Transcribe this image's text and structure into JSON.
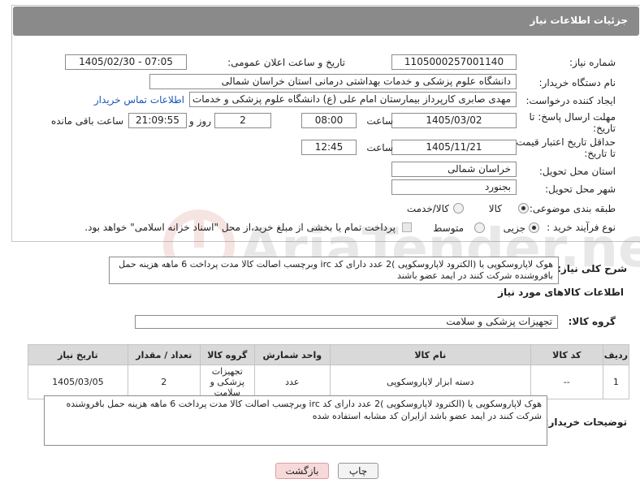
{
  "header": {
    "title": "جزئیات اطلاعات نیاز"
  },
  "fields": {
    "need_number_label": "شماره نیاز:",
    "need_number": "1105000257001140",
    "announce_label": "تاریخ و ساعت اعلان عمومی:",
    "announce_value": "1405/02/30 - 07:05",
    "buyer_org_label": "نام دستگاه خریدار:",
    "buyer_org": "دانشگاه علوم پزشکی و خدمات بهداشتی درمانی استان خراسان شمالی",
    "requester_label": "ایجاد کننده درخواست:",
    "requester": "مهدی صابری کارپرداز بیمارستان امام علی (ع) دانشگاه علوم پزشکی و خدمات ب",
    "contact_link": "اطلاعات تماس خریدار",
    "deadline_label_1": "مهلت ارسال پاسخ: تا",
    "deadline_label_2": "تاریخ:",
    "deadline_date": "1405/03/02",
    "time_label": "ساعت",
    "deadline_time": "08:00",
    "days_value": "2",
    "days_label": "روز و",
    "remaining_time": "21:09:55",
    "remaining_label": "ساعت باقی مانده",
    "validity_label_1": "حداقل تاریخ اعتبار قیمت:",
    "validity_label_2": "تا تاریخ:",
    "validity_date": "1405/11/21",
    "validity_time": "12:45",
    "province_label": "استان محل تحویل:",
    "province": "خراسان شمالی",
    "city_label": "شهر محل تحویل:",
    "city": "بجنورد",
    "category_label": "طبقه بندی موضوعی:",
    "category_options": [
      "کالا",
      "کالا/خدمت"
    ],
    "category_selected": "کالا",
    "process_label": "نوع فرآیند خرید :",
    "process_options": [
      "جزیی",
      "متوسط"
    ],
    "process_selected": "جزیی",
    "payment_note": "پرداخت تمام یا بخشی از مبلغ خرید،از محل \"اسناد خزانه اسلامی\" خواهد بود."
  },
  "description": {
    "label": "شرح کلی نیاز:",
    "text": "هوک لاپاروسکوپی یا (الکترود لاپاروسکوپی )2 عدد دارای کد irc وبرچسب اصالت کالا مدت پرداخت 6 ماهه هزینه حمل بافروشنده شرکت کنند در ایمد عضو باشند"
  },
  "goods_info": {
    "title": "اطلاعات کالاهای مورد نیاز",
    "group_label": "گروه کالا:",
    "group_value": "تجهیزات پزشکی و سلامت"
  },
  "table": {
    "headers": [
      "ردیف",
      "کد کالا",
      "نام کالا",
      "واحد شمارش",
      "گروه کالا",
      "تعداد / مقدار",
      "تاریخ نیاز"
    ],
    "rows": [
      {
        "row": "1",
        "code": "--",
        "name": "دسته ابزار لاپاروسکوپی",
        "unit": "عدد",
        "group": "تجهیزات پزشکی و سلامت",
        "qty": "2",
        "date": "1405/03/05"
      }
    ]
  },
  "buyer_notes": {
    "label": "توضیحات خریدار:",
    "text": "هوک لاپاروسکوپی یا (الکترود لاپاروسکوپی )2 عدد دارای کد irc وبرچسب اصالت کالا مدت پرداخت 6 ماهه هزینه حمل بافروشنده شرکت کنند در ایمد عضو باشد ازایران کد مشابه استفاده شده"
  },
  "buttons": {
    "print": "چاپ",
    "back": "بازگشت"
  },
  "watermark": {
    "text": "AriaTender.neT"
  },
  "colors": {
    "header_bg": "#8a8a8a",
    "link": "#1a56b8",
    "back_btn_bg": "#f7d9d9",
    "watermark": "#c0392b"
  }
}
